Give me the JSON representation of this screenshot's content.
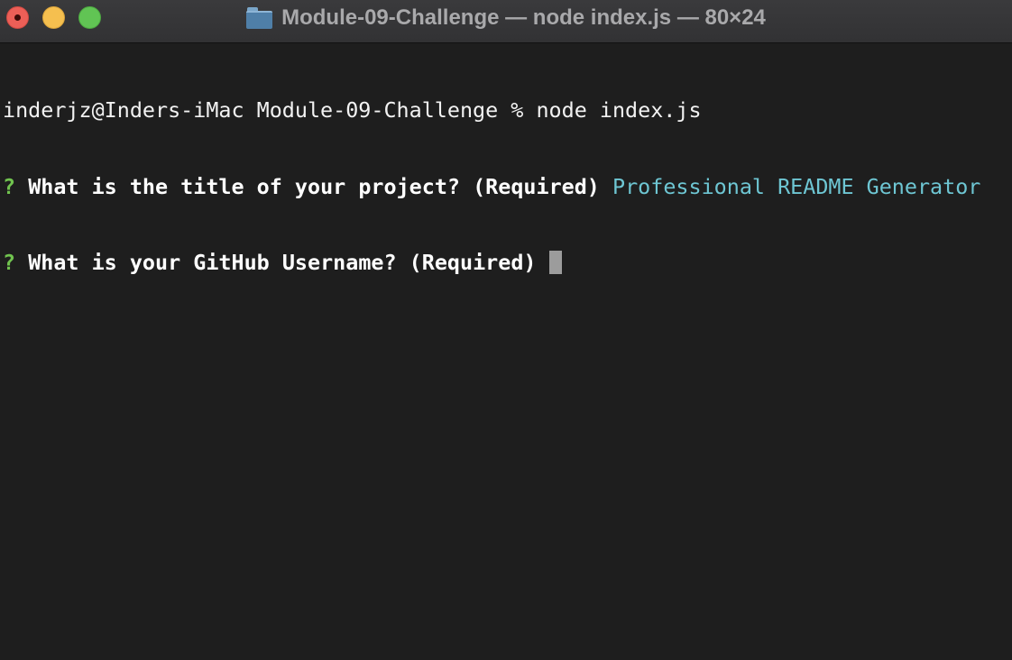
{
  "window": {
    "title": "Module-09-Challenge — node index.js — 80×24",
    "folder_icon": "folder-icon"
  },
  "terminal": {
    "prompt_line": "inderjz@Inders-iMac Module-09-Challenge % node index.js",
    "lines": [
      {
        "marker": "?",
        "question": "What is the title of your project? (Required)",
        "answer": "Professional README Generator"
      },
      {
        "marker": "?",
        "question": "What is your GitHub Username? (Required)",
        "answer": ""
      }
    ]
  },
  "colors": {
    "background": "#1e1e1e",
    "question_marker": "#71c44f",
    "answer_text": "#6ec6d3",
    "cursor": "#9c9c9c"
  }
}
